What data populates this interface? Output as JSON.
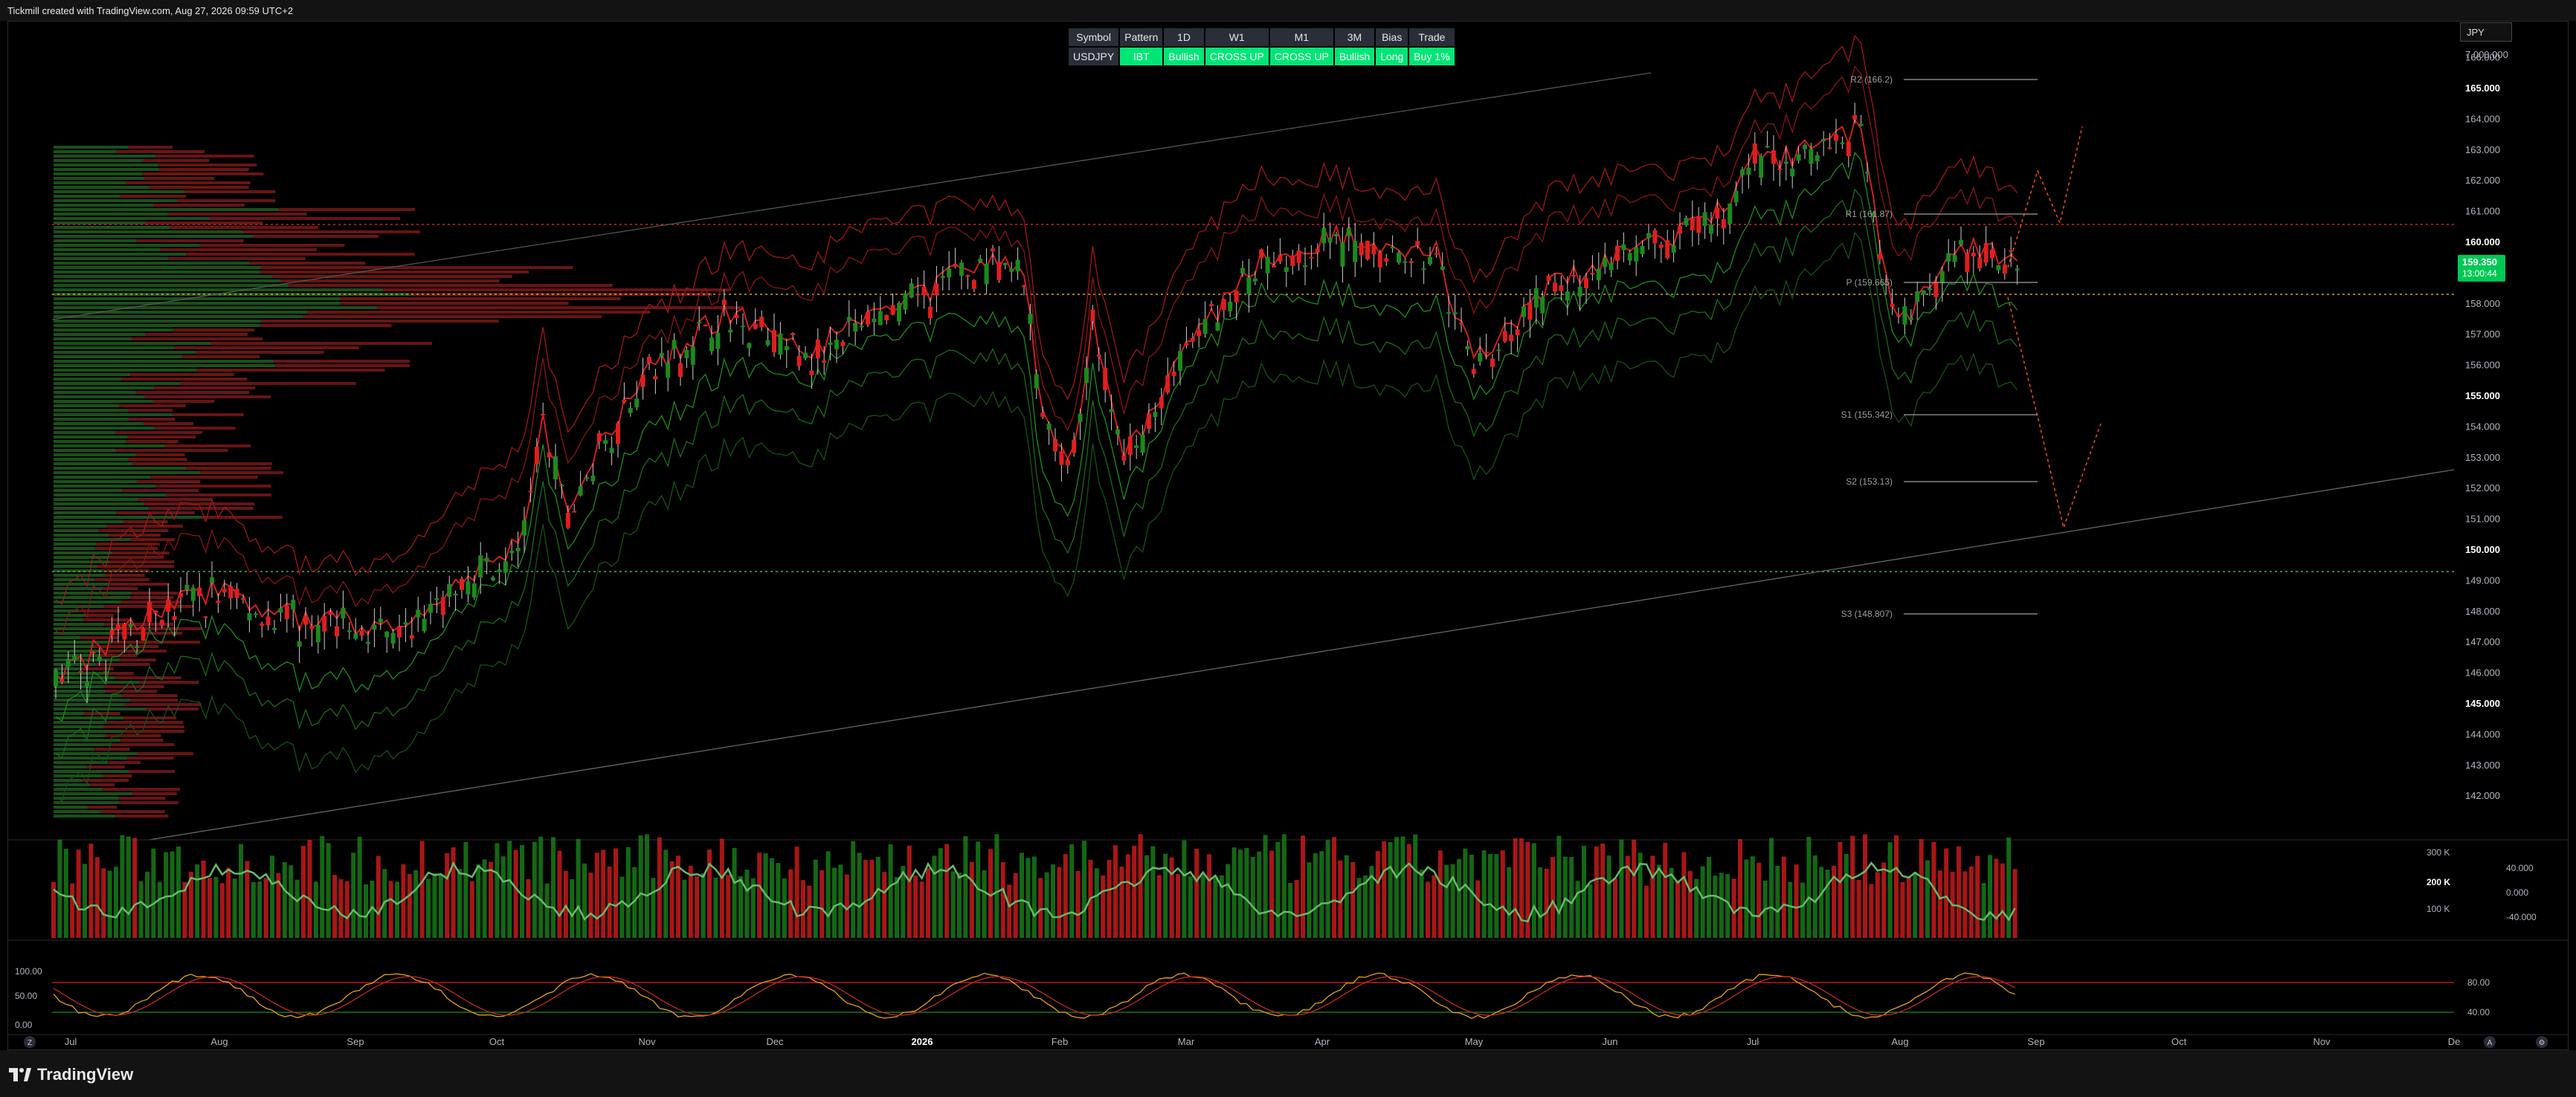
{
  "header": {
    "title": "Tickmill created with TradingView.com, Aug 27, 2026 09:59 UTC+2"
  },
  "footer": {
    "brand": "TradingView"
  },
  "currency_button": "JPY",
  "info_table": {
    "headers": [
      "Symbol",
      "Pattern",
      "1D",
      "W1",
      "M1",
      "3M",
      "Bias",
      "Trade"
    ],
    "values": [
      "USDJPY",
      "IBT",
      "Bullish",
      "CROSS UP",
      "CROSS UP",
      "Bullish",
      "Long",
      "Buy 1%"
    ]
  },
  "price_axis": {
    "labels": [
      "7,000.000",
      "166.000",
      "165.000",
      "164.000",
      "163.000",
      "162.000",
      "161.000",
      "160.000",
      "158.000",
      "157.000",
      "156.000",
      "155.000",
      "154.000",
      "153.000",
      "152.000",
      "151.000",
      "150.000",
      "149.000",
      "148.000",
      "147.000",
      "146.000",
      "145.000",
      "144.000",
      "143.000",
      "142.000"
    ],
    "bold": [
      "165.000",
      "160.000",
      "155.000",
      "150.000",
      "145.000"
    ]
  },
  "last_price": {
    "value": "159.350",
    "countdown": "13:00:44",
    "color": "#00c853"
  },
  "pivots": [
    {
      "label": "R2 (166.2)"
    },
    {
      "label": "R1 (161.87)"
    },
    {
      "label": "P (159.665)"
    },
    {
      "label": "S1 (155.342)"
    },
    {
      "label": "S2 (153.13)"
    },
    {
      "label": "S3 (148.807)"
    }
  ],
  "time_axis": [
    "Jul",
    "Aug",
    "Sep",
    "Oct",
    "Nov",
    "Dec",
    "2026",
    "Feb",
    "Mar",
    "Apr",
    "May",
    "Jun",
    "Jul",
    "Aug",
    "Sep",
    "Oct",
    "Nov",
    "De"
  ],
  "volume_axis": {
    "left": [
      "300 K",
      "200 K",
      "100 K"
    ],
    "right": [
      "40.000",
      "0.000",
      "-40.000"
    ]
  },
  "stoch_axis": {
    "left": [
      "100.00",
      "50.00",
      "0.00"
    ],
    "right": [
      "80.00",
      "40.00"
    ]
  },
  "axis_buttons": [
    "A",
    "⚙"
  ],
  "left_button": "Z",
  "colors": {
    "up": "#1b8a1b",
    "down": "#e01e1e",
    "background": "#000000"
  }
}
